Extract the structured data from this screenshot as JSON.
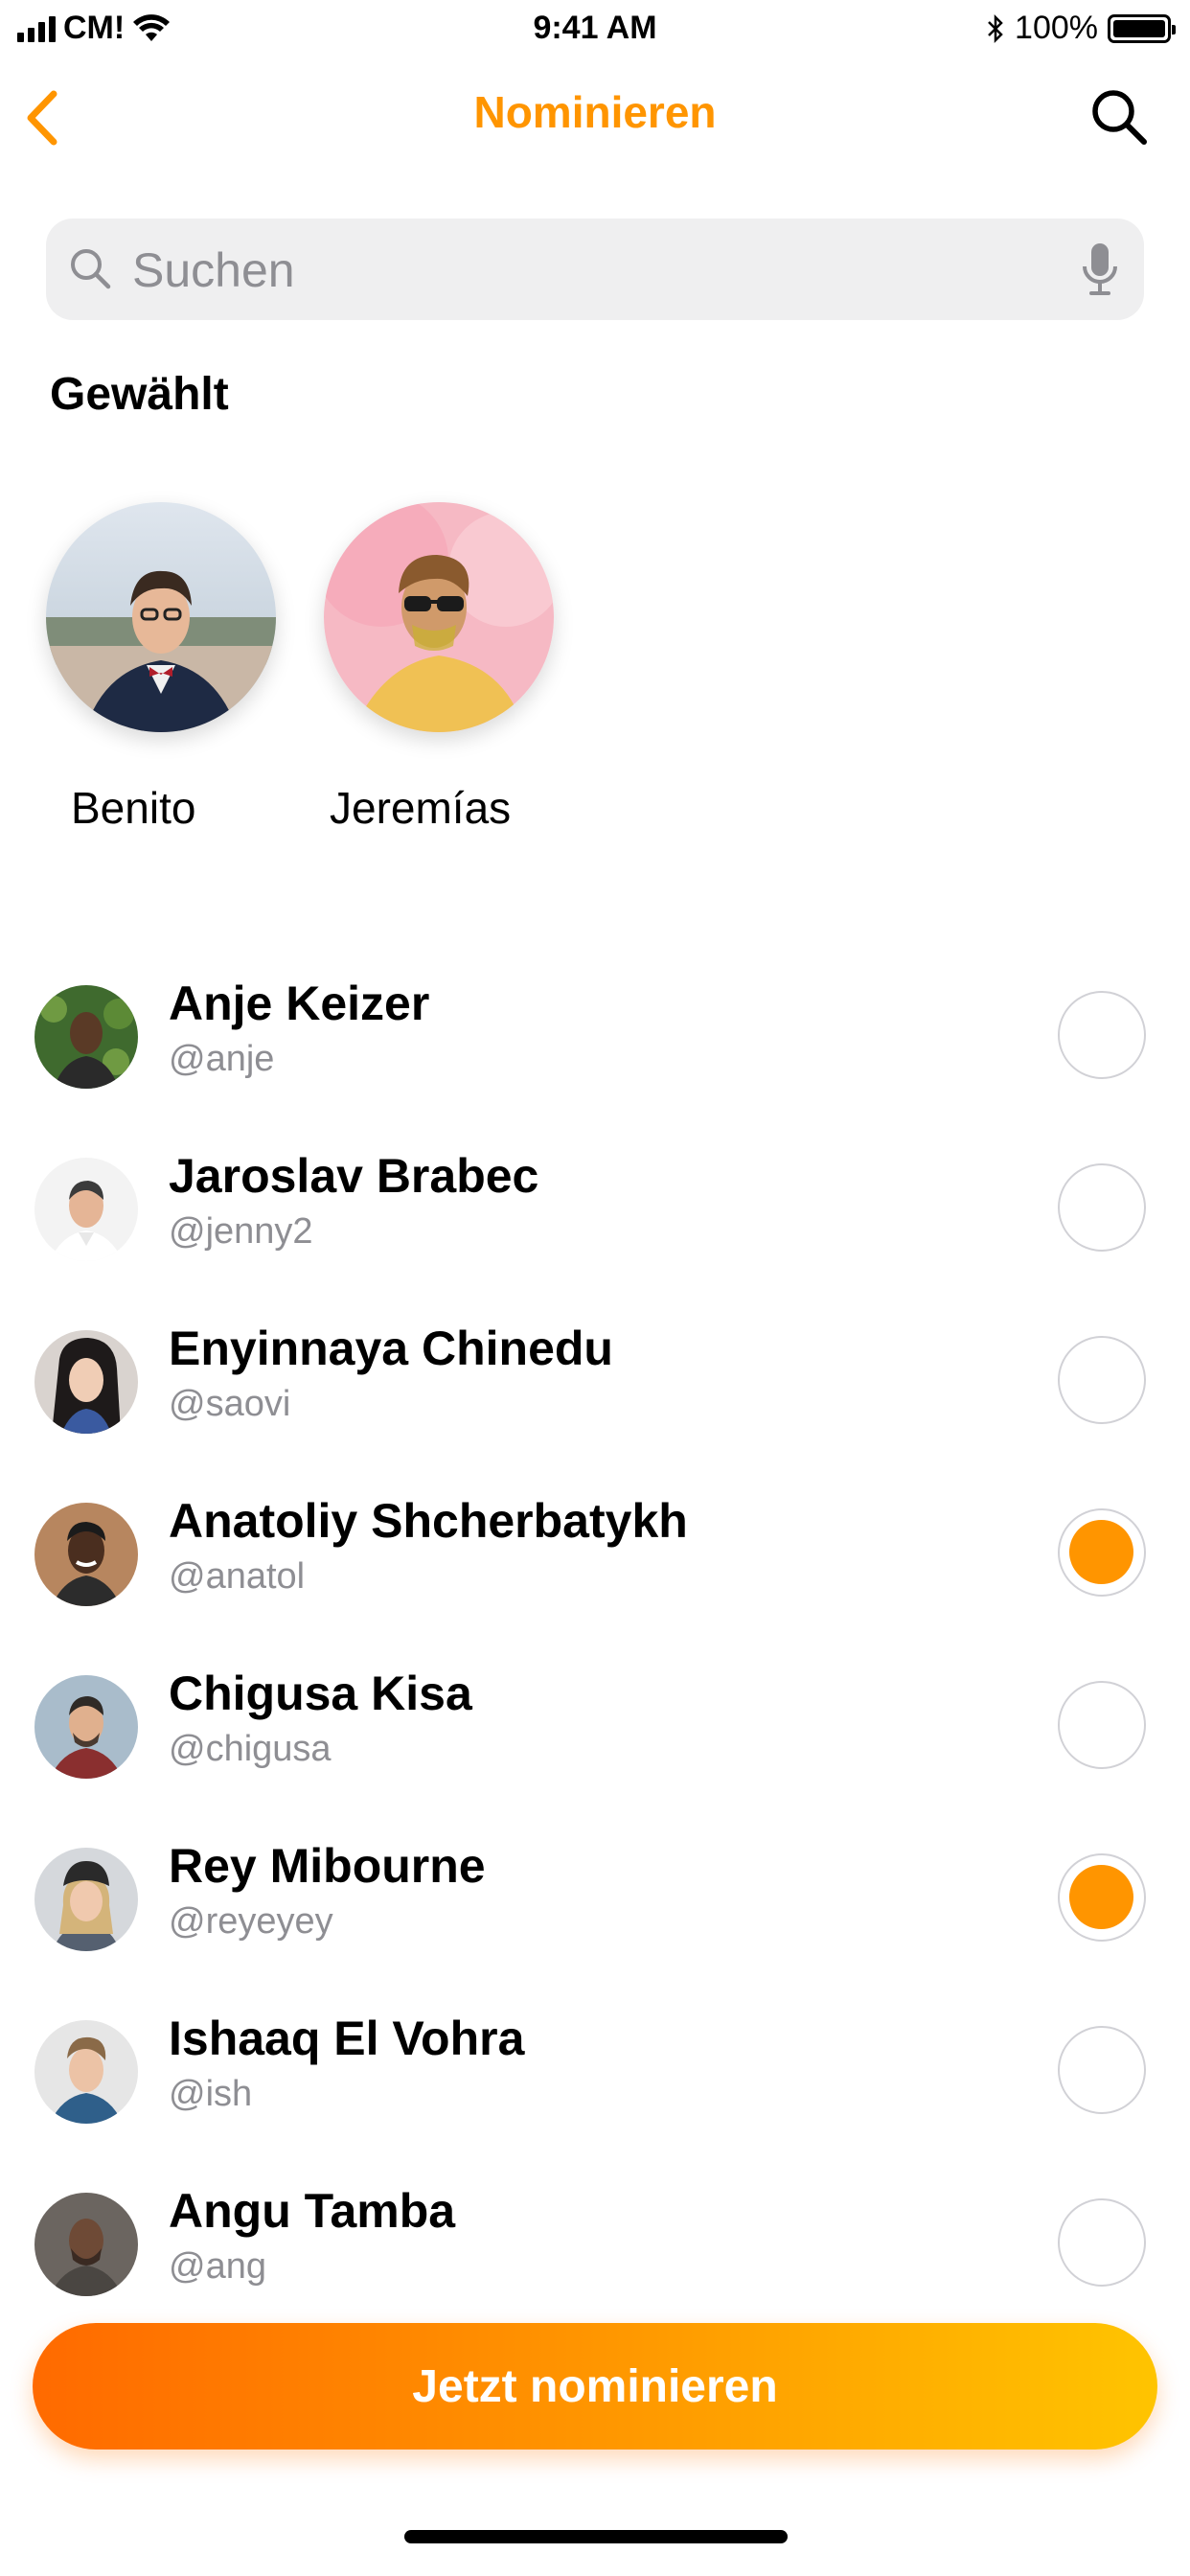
{
  "status_bar": {
    "carrier": "CM!",
    "time": "9:41 AM",
    "battery": "100%"
  },
  "nav": {
    "title": "Nominieren",
    "back_icon": "chevron-left-icon",
    "search_icon": "search-icon"
  },
  "search": {
    "placeholder": "Suchen",
    "value": ""
  },
  "selected_section": {
    "title": "Gewählt",
    "people": [
      {
        "name": "Benito"
      },
      {
        "name": "Jeremías"
      }
    ]
  },
  "contacts": [
    {
      "name": "Anje Keizer",
      "handle": "@anje",
      "selected": false
    },
    {
      "name": "Jaroslav Brabec",
      "handle": "@jenny2",
      "selected": false
    },
    {
      "name": "Enyinnaya Chinedu",
      "handle": "@saovi",
      "selected": false
    },
    {
      "name": "Anatoliy Shcherbatykh",
      "handle": "@anatol",
      "selected": true
    },
    {
      "name": "Chigusa Kisa",
      "handle": "@chigusa",
      "selected": false
    },
    {
      "name": "Rey Mibourne",
      "handle": "@reyeyey",
      "selected": true
    },
    {
      "name": "Ishaaq El Vohra",
      "handle": "@ish",
      "selected": false
    },
    {
      "name": "Angu Tamba",
      "handle": "@ang",
      "selected": false
    }
  ],
  "cta": {
    "label": "Jetzt nominieren"
  },
  "colors": {
    "accent": "#FF9500",
    "gradient_start": "#FF6A00",
    "gradient_end": "#FFC400"
  }
}
